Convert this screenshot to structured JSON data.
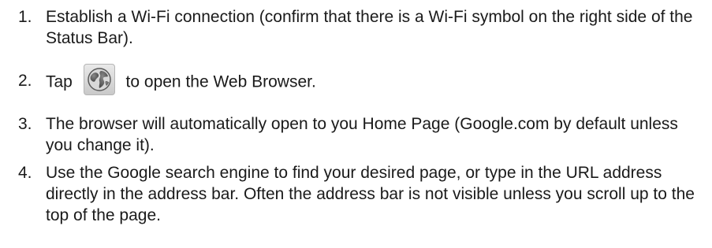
{
  "steps": [
    {
      "number": "1.",
      "text": "Establish a Wi-Fi connection (confirm that there is a Wi-Fi symbol on the right side of the Status Bar)."
    },
    {
      "number": "2.",
      "text_before": "Tap",
      "icon": "globe-browser-icon",
      "text_after": "to open the Web Browser."
    },
    {
      "number": "3.",
      "text": "The browser will automatically open to you Home Page (Google.com by default unless you change it)."
    },
    {
      "number": "4.",
      "text": "Use the Google search engine to find your desired page, or type in the URL address directly in the address bar. Often the address bar is not visible unless you scroll up to the top of the page."
    }
  ]
}
